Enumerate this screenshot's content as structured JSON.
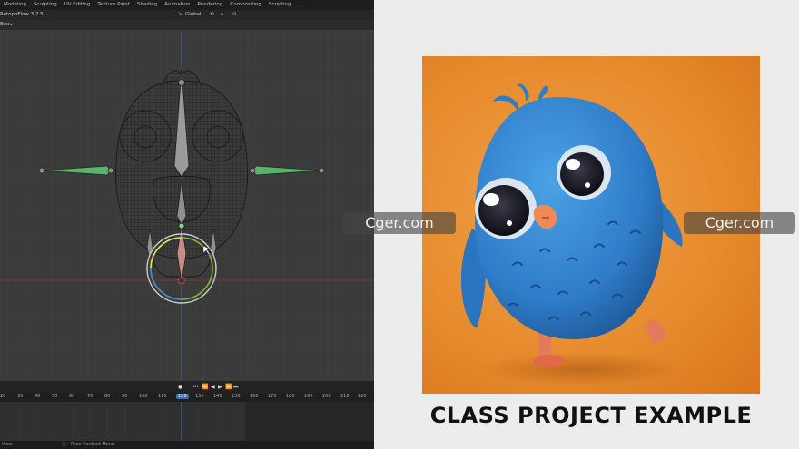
{
  "blender": {
    "workspace_tabs": [
      "Modeling",
      "Sculpting",
      "UV Editing",
      "Texture Paint",
      "Shading",
      "Animation",
      "Rendering",
      "Compositing",
      "Scripting"
    ],
    "add_workspace": "+",
    "addon_label": "RetopoFlow 3.2.5",
    "transform_orientation": "Global",
    "select_mode": "Box",
    "timeline_ticks": [
      "20",
      "30",
      "40",
      "50",
      "60",
      "70",
      "80",
      "90",
      "100",
      "110",
      "120",
      "130",
      "140",
      "150",
      "160",
      "170",
      "180",
      "190",
      "200",
      "210",
      "220"
    ],
    "current_frame": "120",
    "status_left": "View",
    "status_context": "Pose Context Menu"
  },
  "render": {
    "caption": "CLASS PROJECT EXAMPLE"
  },
  "watermarks": [
    "Cger.com",
    "Cger.com"
  ]
}
